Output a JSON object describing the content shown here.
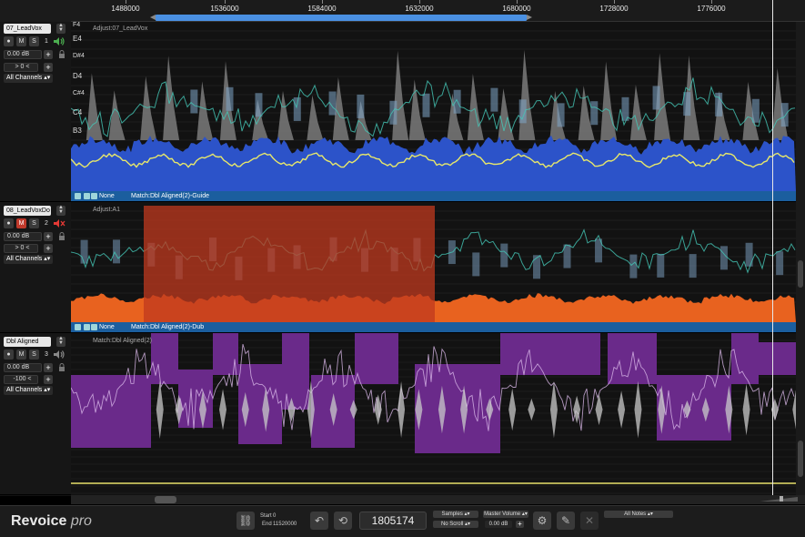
{
  "ruler": {
    "ticks": [
      "1488000",
      "1536000",
      "1584000",
      "1632000",
      "1680000",
      "1728000",
      "1776000"
    ]
  },
  "tracks": [
    {
      "name": "07_LeadVox",
      "number": "1",
      "volume": "0.00 dB",
      "pan": "> 0 <",
      "channels": "All Channels",
      "adjust_label": "Adjust:07_LeadVox",
      "status_none": "None",
      "status_match": "Match:Dbl Aligned(2)-Guide",
      "note_labels": [
        "F4",
        "E4",
        "D#4",
        "D4",
        "C#4",
        "C4",
        "B3"
      ],
      "waveform_color": "#2c53c9",
      "pitch_color": "#e8e86a"
    },
    {
      "name": "08_LeadVoxDo",
      "number": "2",
      "volume": "0.00 dB",
      "pan": "> 0 <",
      "channels": "All Channels",
      "adjust_label": "Adjust:A1",
      "status_none": "None",
      "status_match": "Match:Dbl Aligned(2)-Dub",
      "waveform_color": "#e8621f",
      "selection_color": "#c0391f"
    },
    {
      "name": "Dbl Aligned",
      "number": "3",
      "volume": "0.00 dB",
      "pan": "-100 <",
      "channels": "All Channels",
      "adjust_label": "Match:Dbl Aligned(2)",
      "block_color": "#6a2a8a"
    }
  ],
  "transport": {
    "brand": "Revoice",
    "brand_suffix": "pro",
    "start_label": "Start",
    "start_value": "0",
    "end_label": "End",
    "end_value": "11520000",
    "counter": "1805174",
    "units": "Samples",
    "scroll": "No Scroll",
    "master_volume_label": "Master Volume",
    "master_volume": "0.00 dB",
    "notes_filter": "All Notes"
  }
}
